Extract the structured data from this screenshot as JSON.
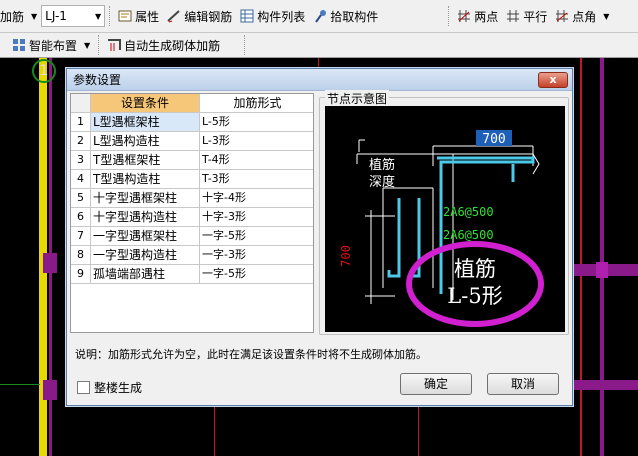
{
  "toolbar1": {
    "left_combo": "加筋",
    "lj_combo": "LJ-1",
    "attr": "属性",
    "edit_rebar": "编辑钢筋",
    "member_list": "构件列表",
    "pick_member": "拾取构件",
    "two_points": "两点",
    "parallel": "平行",
    "point_angle": "点角"
  },
  "toolbar2": {
    "smart_layout": "智能布置",
    "auto_gen": "自动生成砌体加筋"
  },
  "canvas": {
    "axis_label": "1"
  },
  "dialog": {
    "title": "参数设置",
    "close": "x",
    "table": {
      "headers": [
        "设置条件",
        "加筋形式"
      ],
      "rows": [
        {
          "n": "1",
          "cond": "L型遇框架柱",
          "form": "L-5形"
        },
        {
          "n": "2",
          "cond": "L型遇构造柱",
          "form": "L-3形"
        },
        {
          "n": "3",
          "cond": "T型遇框架柱",
          "form": "T-4形"
        },
        {
          "n": "4",
          "cond": "T型遇构造柱",
          "form": "T-3形"
        },
        {
          "n": "5",
          "cond": "十字型遇框架柱",
          "form": "十字-4形"
        },
        {
          "n": "6",
          "cond": "十字型遇构造柱",
          "form": "十字-3形"
        },
        {
          "n": "7",
          "cond": "一字型遇框架柱",
          "form": "一字-5形"
        },
        {
          "n": "8",
          "cond": "一字型遇构造柱",
          "form": "一字-3形"
        },
        {
          "n": "9",
          "cond": "孤墙端部遇柱",
          "form": "一字-5形"
        }
      ]
    },
    "preview": {
      "legend": "节点示意图",
      "dim_top": "700",
      "dim_left": "700",
      "label_depth_1": "植筋",
      "label_depth_2": "深度",
      "rebar_1": "2A6@500",
      "rebar_2": "2A6@500",
      "big_1": "植筋",
      "big_2": "L-5形"
    },
    "note": "说明：加筋形式允许为空，此时在满足该设置条件时将不生成砌体加筋。",
    "whole_building": "整楼生成",
    "ok": "确定",
    "cancel": "取消"
  }
}
